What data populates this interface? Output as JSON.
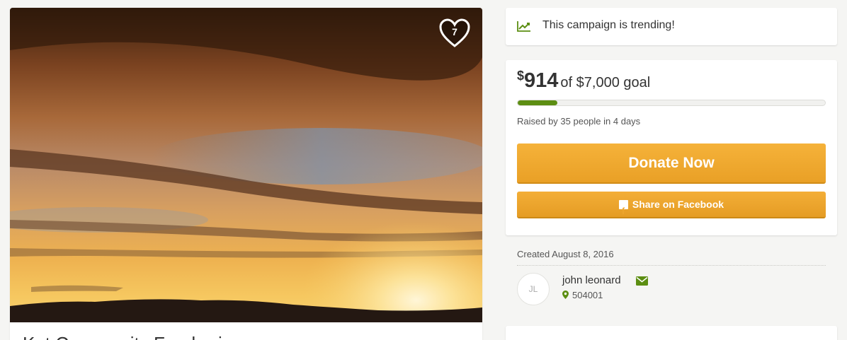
{
  "campaign": {
    "favorites_count": "7",
    "title": "Kat Community Fund-rai..."
  },
  "trending": {
    "icon": "trend-line-icon",
    "text": "This campaign is trending!"
  },
  "donation": {
    "currency_symbol": "$",
    "raised_amount": "914",
    "goal_text": "of $7,000 goal",
    "progress_fraction": 0.13,
    "raised_by_text": "Raised by 35 people in 4 days",
    "donate_label": "Donate Now",
    "share_label": "Share on Facebook"
  },
  "organizer": {
    "created_text": "Created August 8, 2016",
    "initials": "JL",
    "name": "john leonard",
    "location": "504001"
  },
  "colors": {
    "accent_green": "#5c8e12",
    "button_orange": "#f0a830"
  }
}
